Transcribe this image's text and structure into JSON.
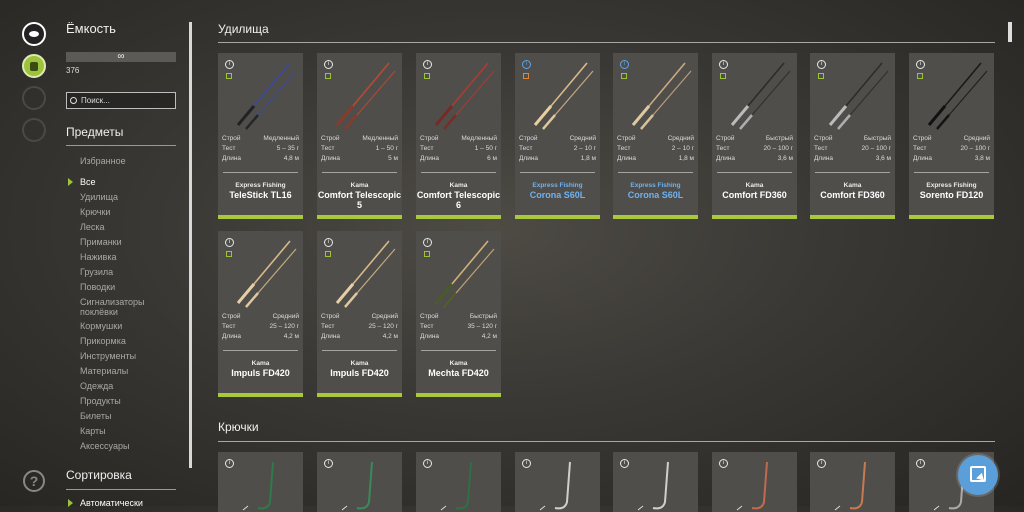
{
  "capacity": {
    "title": "Ёмкость",
    "bar_value": "∞",
    "count": "376"
  },
  "search": {
    "placeholder": "Поиск..."
  },
  "items_section": {
    "title": "Предметы",
    "categories": [
      "Избранное",
      "Все",
      "Удилища",
      "Крючки",
      "Леска",
      "Приманки",
      "Наживка",
      "Грузила",
      "Поводки",
      "Сигнализаторы поклёвки",
      "Кормушки",
      "Прикормка",
      "Инструменты",
      "Материалы",
      "Одежда",
      "Продукты",
      "Билеты",
      "Карты",
      "Аксессуары"
    ],
    "active_category": "Все"
  },
  "sort_section": {
    "title": "Сортировка",
    "selected": "Автоматически"
  },
  "main": {
    "rods_title": "Удилища",
    "hooks_title": "Крючки"
  },
  "labels": {
    "action": "Строй",
    "test": "Тест",
    "length": "Длина",
    "info": "i"
  },
  "colors": {
    "accent_green": "#a9c93a",
    "link_blue": "#6fb2f0",
    "card_bg": "#4f4e4b"
  },
  "rods": [
    {
      "brand": "Express Fishing",
      "model": "TeleStick TL16",
      "action": "Медленный",
      "test": "5 – 35 г",
      "length": "4,8 м",
      "highlight": "none"
    },
    {
      "brand": "Kama",
      "model": "Comfort Telescopic 5",
      "action": "Медленный",
      "test": "1 – 50 г",
      "length": "5 м",
      "highlight": "none"
    },
    {
      "brand": "Kama",
      "model": "Comfort Telescopic 6",
      "action": "Медленный",
      "test": "1 – 50 г",
      "length": "6 м",
      "highlight": "none"
    },
    {
      "brand": "Express Fishing",
      "model": "Corona S60L",
      "action": "Средний",
      "test": "2 – 10 г",
      "length": "1,8 м",
      "highlight": "blue"
    },
    {
      "brand": "Express Fishing",
      "model": "Corona S60L",
      "action": "Средний",
      "test": "2 – 10 г",
      "length": "1,8 м",
      "highlight": "blue"
    },
    {
      "brand": "Kama",
      "model": "Comfort FD360",
      "action": "Быстрый",
      "test": "20 – 100 г",
      "length": "3,6 м",
      "highlight": "none"
    },
    {
      "brand": "Kama",
      "model": "Comfort FD360",
      "action": "Быстрый",
      "test": "20 – 100 г",
      "length": "3,6 м",
      "highlight": "none"
    },
    {
      "brand": "Express Fishing",
      "model": "Sorento FD120",
      "action": "Средний",
      "test": "20 – 100 г",
      "length": "3,8 м",
      "highlight": "none"
    },
    {
      "brand": "Kama",
      "model": "Impuls FD420",
      "action": "Средний",
      "test": "25 – 120 г",
      "length": "4,2 м",
      "highlight": "none"
    },
    {
      "brand": "Kama",
      "model": "Impuls FD420",
      "action": "Средний",
      "test": "25 – 120 г",
      "length": "4,2 м",
      "highlight": "none"
    },
    {
      "brand": "Kama",
      "model": "Mechta FD420",
      "action": "Быстрый",
      "test": "35 – 120 г",
      "length": "4,2 м",
      "highlight": "none"
    }
  ],
  "rod_icons": [
    {
      "color": "#3b4a9a",
      "handle": "#222222"
    },
    {
      "color": "#b84a32",
      "handle": "#8a3a2a"
    },
    {
      "color": "#b03a30",
      "handle": "#7a2a24"
    },
    {
      "color": "#d9b98a",
      "handle": "#e8cfa0"
    },
    {
      "color": "#c9a983",
      "handle": "#e0c8a2"
    },
    {
      "color": "#2c2c2c",
      "handle": "#bbbbbb"
    },
    {
      "color": "#2c2c2c",
      "handle": "#bbbbbb"
    },
    {
      "color": "#1a1a1a",
      "handle": "#111111"
    },
    {
      "color": "#d8b987",
      "handle": "#e6cfa5"
    },
    {
      "color": "#d8b987",
      "handle": "#e6cfa5"
    },
    {
      "color": "#d3b07a",
      "handle": "#4a5a2a"
    }
  ],
  "hook_icons": [
    {
      "color": "#2f7a4a"
    },
    {
      "color": "#3a8a5a"
    },
    {
      "color": "#2f6f45"
    },
    {
      "color": "#cfcfcf"
    },
    {
      "color": "#cfcfcf"
    },
    {
      "color": "#c06a50"
    },
    {
      "color": "#c77a50"
    },
    {
      "color": "#aaaaaa"
    }
  ]
}
